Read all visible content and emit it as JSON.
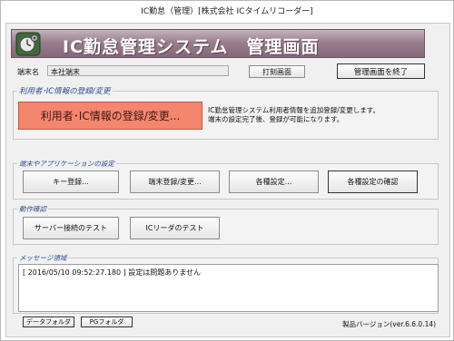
{
  "window": {
    "title": "IC勤怠（管理）[株式会社 ICタイムリコーダー]"
  },
  "banner": {
    "title": "IC勤怠管理システム　管理画面",
    "logo_icon": "clock-gear-icon"
  },
  "terminal": {
    "label": "端末名",
    "value": "本社端末"
  },
  "toolbar": {
    "print_label": "打刻画面",
    "exit_label": "管理画面を終了"
  },
  "registration": {
    "legend": "利用者･IC情報の登録/変更",
    "button_label": "利用者･IC情報の登録/変更...",
    "description_line1": "IC勤怠管理システム利用者情報を追加登録/変更します。",
    "description_line2": "端末の設定完了後、登録が可能になります。"
  },
  "settings": {
    "legend": "端末やアプリケーションの設定",
    "key_label": "キー登録...",
    "terminal_label": "端末登録/変更...",
    "various_label": "各種設定...",
    "confirm_label": "各種設定の確認"
  },
  "diagnostics": {
    "legend": "動作確認",
    "server_test_label": "サーバー接続のテスト",
    "reader_test_label": "ICリーダのテスト"
  },
  "messages": {
    "legend": "メッセージ領域",
    "lines": [
      "[ 2016/05/10 09:52:27.180 ] 設定は問題ありません"
    ]
  },
  "footer": {
    "data_folder_label": "データフォルダ",
    "pg_folder_label": "PGフォルダ",
    "version": "製品バージョン(ver.6.6.0.14)"
  },
  "colors": {
    "banner": "#9a7f8d",
    "primary_button": "#f5866e",
    "legend_text": "#2f4f8f"
  }
}
